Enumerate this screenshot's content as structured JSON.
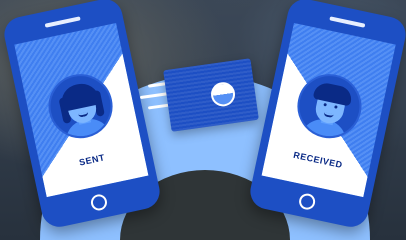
{
  "left_phone": {
    "label": "SENT",
    "icon": "avatar-woman-icon"
  },
  "right_phone": {
    "label": "RECEIVED",
    "icon": "avatar-man-icon"
  },
  "envelope": {
    "icon": "envelope-icon",
    "motion_icon": "motion-lines-icon"
  },
  "colors": {
    "primary_blue": "#1d4fc4",
    "light_blue": "#4a8cf7",
    "arch_blue": "#8ec0ff",
    "white": "#ffffff"
  }
}
